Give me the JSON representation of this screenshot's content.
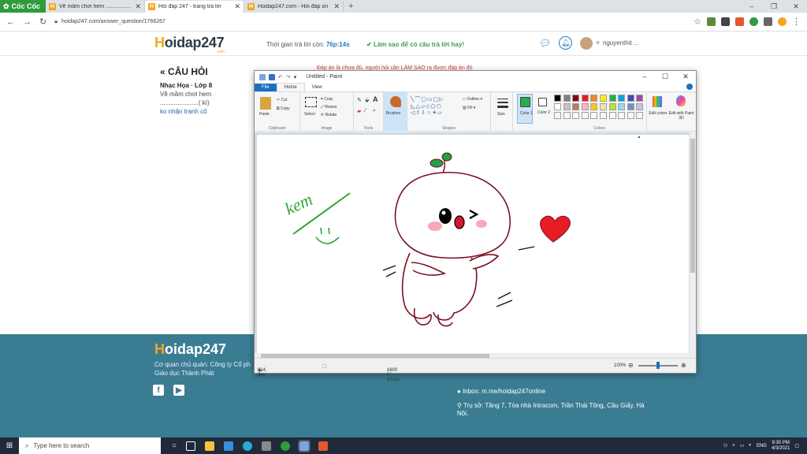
{
  "browser": {
    "brand": "Cốc Cốc",
    "tabs": [
      {
        "title": "Vẽ mầm chơi hem ...................",
        "active": false
      },
      {
        "title": "Hỏi đáp 247 - trang tra lời",
        "active": true
      },
      {
        "title": "Hoidap247.com - Hỏi đáp on",
        "active": false
      }
    ],
    "url": "hoidap247.com/answer_question/1766267"
  },
  "site": {
    "logo_prefix": "H",
    "logo_rest": "oidap247",
    "logo_small": ".com",
    "timer_label": "Thời gian trả lời còn: ",
    "timer_value": "76p:14s",
    "howto": "Làm sao để có câu trả lời hay!",
    "username": "nguyenthit ..."
  },
  "question": {
    "title": "CÂU HỎI",
    "subject": "Nhạc Họa · Lớp 8",
    "line1": "Vẽ mầm chơi hem",
    "line2": "......................( kì)",
    "line3": "ko nhận tranh cũ",
    "answer_hint": "Đáp án là chưa đủ, người hỏi cần LÀM SAO ra được đáp án đó"
  },
  "footer": {
    "logo_prefix": "H",
    "logo_rest": "oidap247",
    "company": "Cơ quan chủ quản: Công ty Cổ ph",
    "company2": "Giáo dục Thành Phát",
    "inbox": "Inbox: m.me/hoidap247online",
    "address": "Trụ sở: Tầng 7, Tòa nhà Intracom, Trần Thái Tông, Cầu Giấy, Hà Nội."
  },
  "paint": {
    "title": "Untitled - Paint",
    "tabs": [
      "File",
      "Home",
      "View"
    ],
    "groups": [
      "Clipboard",
      "Image",
      "Tools",
      "Shapes",
      "Colors"
    ],
    "clipboard": {
      "paste": "Paste",
      "cut": "Cut",
      "copy": "Copy"
    },
    "image": {
      "select": "Select",
      "crop": "Crop",
      "resize": "Resize",
      "rotate": "Rotate"
    },
    "brushes": "Brushes",
    "shapes": {
      "outline": "Outline",
      "fill": "Fill"
    },
    "size": "Size",
    "color1": "Color 1",
    "color2": "Color 2",
    "edit_colors": "Edit colors",
    "edit_paint3d": "Edit with Paint 3D",
    "palette": [
      "#000000",
      "#7f7f7f",
      "#880015",
      "#ed1c24",
      "#ff7f27",
      "#fff200",
      "#22b14c",
      "#00a2e8",
      "#3f48cc",
      "#a349a4",
      "#ffffff",
      "#c3c3c3",
      "#b97a57",
      "#ffaec9",
      "#ffc90e",
      "#efe4b0",
      "#b5e61d",
      "#99d9ea",
      "#7092be",
      "#c8bfe7"
    ],
    "status": {
      "position": "914, 9px",
      "dimensions": "1600 × 822px",
      "zoom": "100%"
    },
    "drawing_text": "kem"
  },
  "taskbar": {
    "search_placeholder": "Type here to search",
    "lang": "ENG",
    "time": "9:30 PM",
    "date": "4/3/2021"
  },
  "colors": {
    "accent": "#2a7ac2",
    "footer": "#3a7d93",
    "paint_blue": "#1c6fbf",
    "drawing_line": "#7a1020"
  }
}
